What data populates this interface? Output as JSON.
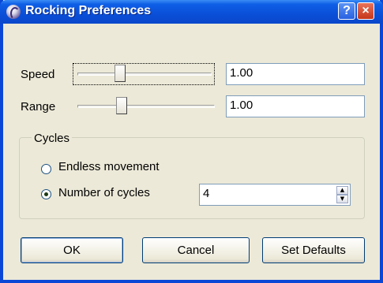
{
  "window": {
    "title": "Rocking Preferences",
    "help_label": "?",
    "close_label": "×"
  },
  "speed": {
    "label": "Speed",
    "value": "1.00",
    "slider_fraction": 0.32
  },
  "range": {
    "label": "Range",
    "value": "1.00",
    "slider_fraction": 0.32
  },
  "cycles": {
    "group_label": "Cycles",
    "options": [
      {
        "label": "Endless movement",
        "checked": false
      },
      {
        "label": "Number of cycles",
        "checked": true
      }
    ],
    "count_value": "4"
  },
  "buttons": {
    "ok": "OK",
    "cancel": "Cancel",
    "set_defaults": "Set Defaults"
  },
  "colors": {
    "titlebar": "#0a4fd8",
    "close": "#c5361a",
    "dialog_bg": "#ece9d8"
  },
  "icons": [
    "app-rocking-icon",
    "help-icon",
    "close-icon",
    "spin-up-icon",
    "spin-down-icon"
  ]
}
